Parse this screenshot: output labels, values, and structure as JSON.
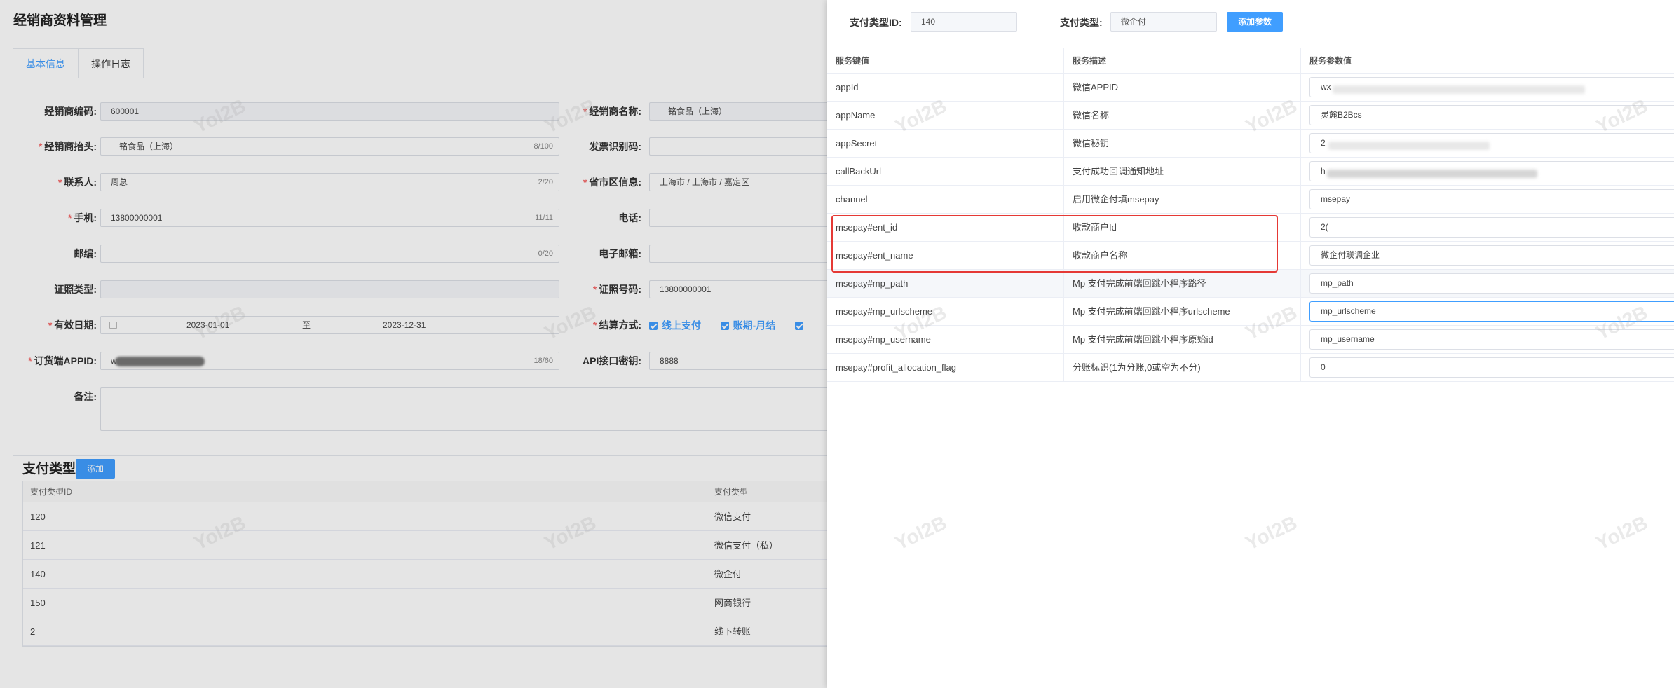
{
  "page": {
    "title": "经销商资料管理",
    "tabs": [
      {
        "label": "基本信息",
        "active": true
      },
      {
        "label": "操作日志",
        "active": false
      }
    ]
  },
  "form": {
    "code": {
      "label": "经销商编码:",
      "value": "600001"
    },
    "name": {
      "label": "经销商名称:",
      "value": "一铭食品（上海）"
    },
    "header": {
      "label": "经销商抬头:",
      "value": "一铭食品（上海）",
      "count": "8/100"
    },
    "invoice": {
      "label": "发票识别码:",
      "value": ""
    },
    "contact": {
      "label": "联系人:",
      "value": "周总",
      "count": "2/20"
    },
    "region": {
      "label": "省市区信息:",
      "value": "上海市 / 上海市 / 嘉定区"
    },
    "mobile": {
      "label": "手机:",
      "value": "13800000001",
      "count": "11/11"
    },
    "phone": {
      "label": "电话:",
      "value": ""
    },
    "postcode": {
      "label": "邮编:",
      "value": "",
      "count": "0/20"
    },
    "email": {
      "label": "电子邮箱:",
      "value": ""
    },
    "license_type": {
      "label": "证照类型:",
      "value": ""
    },
    "license_no": {
      "label": "证照号码:",
      "value": "13800000001"
    },
    "valid_date": {
      "label": "有效日期:",
      "start": "2023-01-01",
      "sep": "至",
      "end": "2023-12-31"
    },
    "settlement": {
      "label": "结算方式:",
      "options": [
        "线上支付",
        "账期-月结"
      ]
    },
    "appid": {
      "label": "订货端APPID:",
      "value": "w",
      "count": "18/60"
    },
    "api_key": {
      "label": "API接口密钥:",
      "value": "8888"
    },
    "remark": {
      "label": "备注:",
      "value": ""
    }
  },
  "payment_types": {
    "title": "支付类型",
    "add_label": "添加",
    "columns": [
      "支付类型ID",
      "支付类型"
    ],
    "rows": [
      [
        "120",
        "微信支付"
      ],
      [
        "121",
        "微信支付（私）"
      ],
      [
        "140",
        "微企付"
      ],
      [
        "150",
        "网商银行"
      ],
      [
        "2",
        "线下转账"
      ]
    ]
  },
  "drawer": {
    "type_id_label": "支付类型ID:",
    "type_id_value": "140",
    "type_label": "支付类型:",
    "type_value": "微企付",
    "add_param_label": "添加参数",
    "columns": [
      "服务键值",
      "服务描述",
      "服务参数值"
    ],
    "rows": [
      {
        "key": "appId",
        "desc": "微信APPID",
        "value": "wx"
      },
      {
        "key": "appName",
        "desc": "微信名称",
        "value": "灵麓B2Bcs"
      },
      {
        "key": "appSecret",
        "desc": "微信秘钥",
        "value": "2"
      },
      {
        "key": "callBackUrl",
        "desc": "支付成功回调通知地址",
        "value": "h"
      },
      {
        "key": "channel",
        "desc": "启用微企付填msepay",
        "value": "msepay"
      },
      {
        "key": "msepay#ent_id",
        "desc": "收款商户Id",
        "value": "2("
      },
      {
        "key": "msepay#ent_name",
        "desc": "收款商户名称",
        "value": "微企付联调企业"
      },
      {
        "key": "msepay#mp_path",
        "desc": "Mp 支付完成前端回跳小程序路径",
        "value": "mp_path"
      },
      {
        "key": "msepay#mp_urlscheme",
        "desc": "Mp 支付完成前端回跳小程序urlscheme",
        "value": "mp_urlscheme"
      },
      {
        "key": "msepay#mp_username",
        "desc": "Mp 支付完成前端回跳小程序原始id",
        "value": "mp_username"
      },
      {
        "key": "msepay#profit_allocation_flag",
        "desc": "分账标识(1为分账,0或空为不分)",
        "value": "0"
      }
    ]
  },
  "watermark": "Yol2B"
}
